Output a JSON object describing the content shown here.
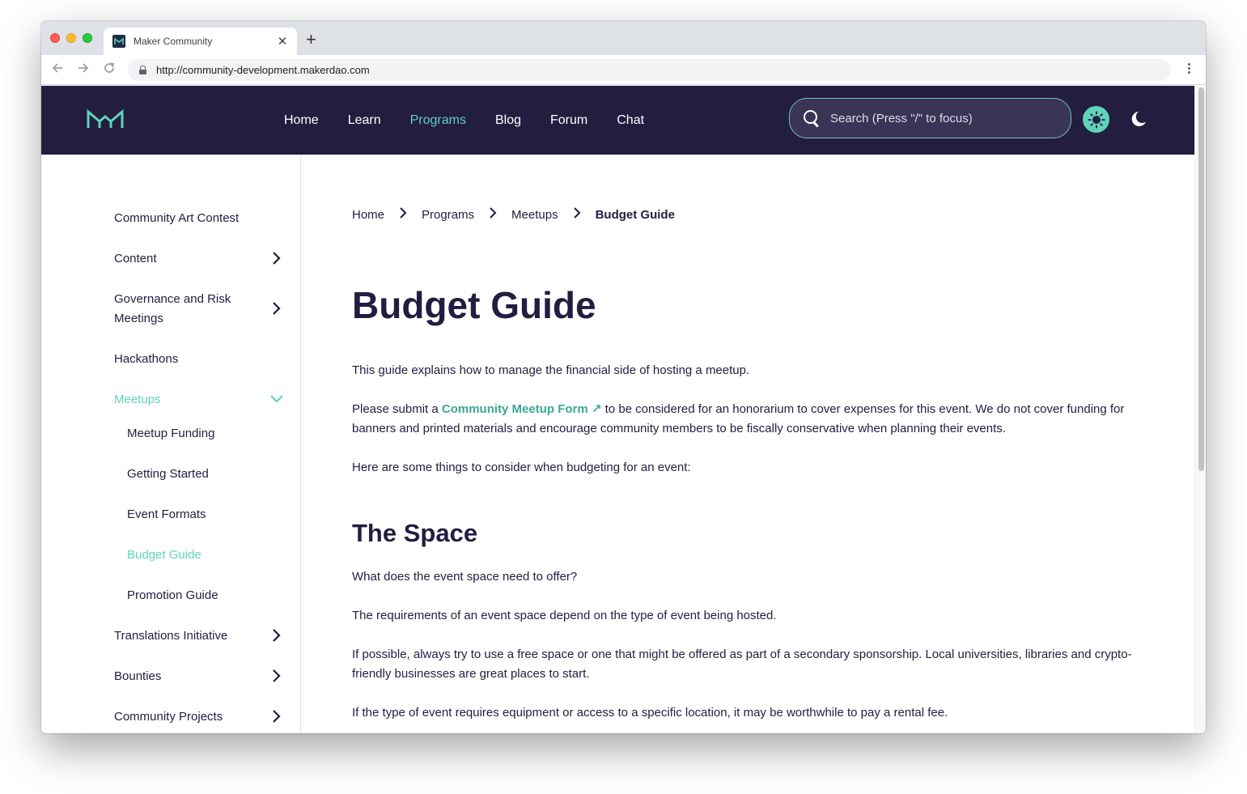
{
  "browser": {
    "tab_title": "Maker Community",
    "tab_close": "✕",
    "new_tab": "+",
    "url": "http://community-development.makerdao.com"
  },
  "header": {
    "nav": [
      "Home",
      "Learn",
      "Programs",
      "Blog",
      "Forum",
      "Chat"
    ],
    "active_nav": "Programs",
    "search_placeholder": "Search (Press \"/\" to focus)",
    "accent_color": "#5fd4b8",
    "header_bg": "#231d40"
  },
  "sidebar": {
    "items": [
      {
        "label": "Community Art Contest"
      },
      {
        "label": "Content"
      },
      {
        "label": "Governance and Risk Meetings"
      },
      {
        "label": "Hackathons"
      },
      {
        "label": "Meetups"
      },
      {
        "label": "Meetup Funding"
      },
      {
        "label": "Getting Started"
      },
      {
        "label": "Event Formats"
      },
      {
        "label": "Budget Guide"
      },
      {
        "label": "Promotion Guide"
      },
      {
        "label": "Translations Initiative"
      },
      {
        "label": "Bounties"
      },
      {
        "label": "Community Projects"
      }
    ]
  },
  "breadcrumb": [
    "Home",
    "Programs",
    "Meetups",
    "Budget Guide"
  ],
  "article": {
    "title": "Budget Guide",
    "intro": "This guide explains how to manage the financial side of hosting a meetup.",
    "submit_prefix": "Please submit a ",
    "submit_link": "Community Meetup Form ↗",
    "submit_suffix": " to be considered for an honorarium to cover expenses for this event. We do not cover funding for banners and printed materials and encourage community members to be fiscally conservative when planning their events.",
    "consider": "Here are some things to consider when budgeting for an event:",
    "section_title": "The Space",
    "q1": "What does the event space need to offer?",
    "p1": "The requirements of an event space depend on the type of event being hosted.",
    "p2": "If possible, always try to use a free space or one that might be offered as part of a secondary sponsorship. Local universities, libraries and crypto-friendly businesses are great places to start.",
    "p3": "If the type of event requires equipment or access to a specific location, it may be worthwhile to pay a rental fee."
  }
}
